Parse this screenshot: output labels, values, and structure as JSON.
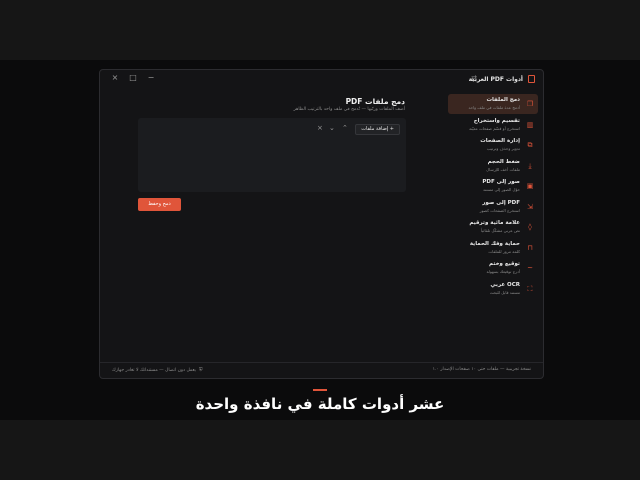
{
  "app": {
    "title": "أدوات PDF العربية",
    "icon": "pdf-file-icon"
  },
  "window_controls": {
    "close": "×",
    "maximize": "□",
    "minimize": "−"
  },
  "sidebar": {
    "items": [
      {
        "label": "دمج الملفات",
        "desc": "أدمج عدة ملفات في ملف واحد",
        "icon": "copy-icon",
        "active": true
      },
      {
        "label": "تقسيم واستخراج",
        "desc": "استخرج أو قسّم صفحات معيّنة",
        "icon": "columns-icon",
        "active": false
      },
      {
        "label": "إدارة الصفحات",
        "desc": "تدوير وحذف وترتيب",
        "icon": "pages-icon",
        "active": false
      },
      {
        "label": "ضغط الحجم",
        "desc": "ملفات أخف للإرسال",
        "icon": "compress-icon",
        "active": false
      },
      {
        "label": "صور إلى PDF",
        "desc": "حوّل الصور إلى مستند",
        "icon": "image-icon",
        "active": false
      },
      {
        "label": "PDF إلى صور",
        "desc": "استخرج الصفحات كصور",
        "icon": "export-icon",
        "active": false
      },
      {
        "label": "علامة مائية وترقيم",
        "desc": "نص عربي مشكّل تلقائياً",
        "icon": "drop-icon",
        "active": false
      },
      {
        "label": "حماية وفك الحماية",
        "desc": "كلمة مرور للملفات",
        "icon": "lock-icon",
        "active": false
      },
      {
        "label": "توقيع وختم",
        "desc": "أدرج توقيعك بسهولة",
        "icon": "signature-icon",
        "active": false
      },
      {
        "label": "OCR عربي",
        "desc": "مستند قابل للبحث",
        "icon": "scan-icon",
        "active": false
      }
    ]
  },
  "main": {
    "title": "دمج ملفات PDF",
    "subtitle": "أضف الملفات ورتّبها — تُدمج في ملف واحد بالترتيب الظاهر",
    "add_button": "+ إضافة ملفات",
    "up_icon": "chevron-up-icon",
    "down_icon": "chevron-down-icon",
    "clear_icon": "close-icon",
    "merge_button": "دمج وحفظ"
  },
  "statusbar": {
    "right": "نسخة تجريبية — ملفات حتى ١٠ صفحات   الإصدار ١.٠",
    "left": "يعمل دون اتصال — مستنداتك لا تغادر جهازك"
  },
  "caption": {
    "text": "عشر أدوات كاملة في نافذة واحدة"
  },
  "colors": {
    "accent": "#e0553a",
    "background": "#141416",
    "active_item": "#3a2620"
  }
}
